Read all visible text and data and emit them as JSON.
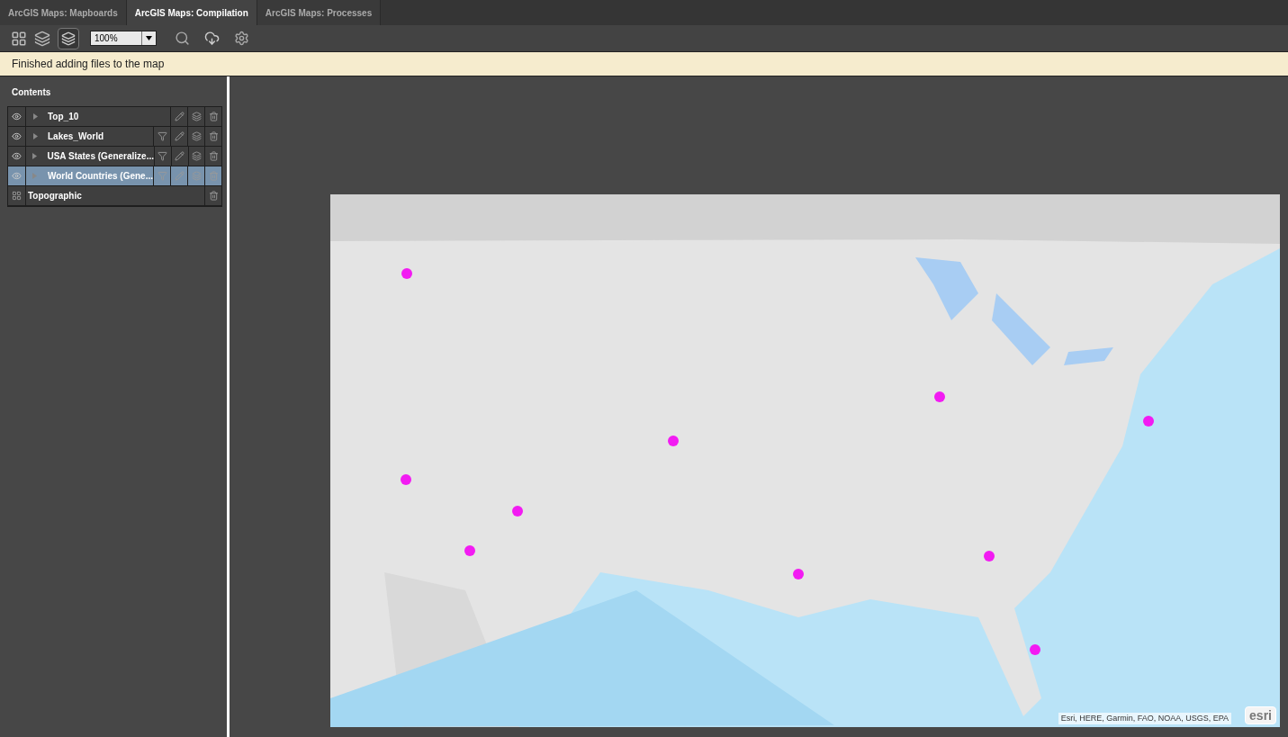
{
  "tabs": [
    {
      "label": "ArcGIS Maps: Mapboards",
      "selected": false
    },
    {
      "label": "ArcGIS Maps: Compilation",
      "selected": true
    },
    {
      "label": "ArcGIS Maps: Processes",
      "selected": false
    }
  ],
  "toolbar": {
    "zoom": "100%"
  },
  "notification": "Finished adding files to the map",
  "contents": {
    "title": "Contents",
    "layers": [
      {
        "kind": "layer",
        "name": "Top_10",
        "filter": false,
        "selected": false
      },
      {
        "kind": "layer",
        "name": "Lakes_World",
        "filter": true,
        "selected": false
      },
      {
        "kind": "layer",
        "name": "USA States (Generalize...",
        "filter": true,
        "selected": false
      },
      {
        "kind": "layer",
        "name": "World Countries (Gene...",
        "filter": true,
        "selected": true
      },
      {
        "kind": "basemap",
        "name": "Topographic"
      }
    ]
  },
  "map": {
    "kind": "picture",
    "attribution": "Esri, HERE, Garmin, FAO, NOAA, USGS, EPA",
    "logo": "esri"
  }
}
